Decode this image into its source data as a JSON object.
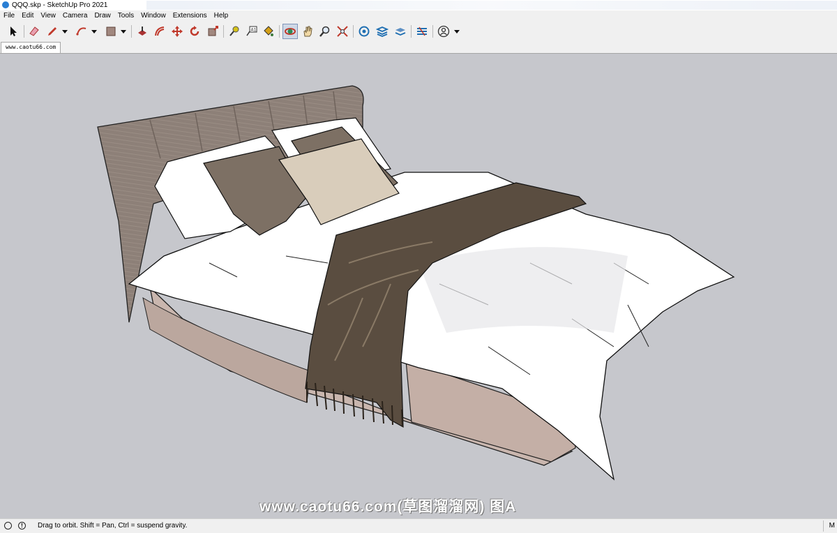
{
  "window": {
    "title": "QQQ.skp - SketchUp Pro 2021"
  },
  "menu": [
    "File",
    "Edit",
    "View",
    "Camera",
    "Draw",
    "Tools",
    "Window",
    "Extensions",
    "Help"
  ],
  "toolbar": {
    "tools": [
      {
        "name": "select-icon"
      },
      {
        "name": "eraser-icon"
      },
      {
        "name": "pencil-icon"
      },
      {
        "name": "arc-icon"
      },
      {
        "name": "rectangle-icon"
      },
      {
        "name": "push-pull-icon"
      },
      {
        "name": "offset-icon"
      },
      {
        "name": "move-icon"
      },
      {
        "name": "rotate-icon"
      },
      {
        "name": "scale-icon"
      },
      {
        "name": "tape-measure-icon"
      },
      {
        "name": "text-icon"
      },
      {
        "name": "paint-bucket-icon"
      },
      {
        "name": "orbit-icon"
      },
      {
        "name": "pan-icon"
      },
      {
        "name": "zoom-icon"
      },
      {
        "name": "zoom-extents-icon"
      },
      {
        "name": "3d-warehouse-icon"
      },
      {
        "name": "extension-warehouse-icon"
      },
      {
        "name": "layout-icon"
      },
      {
        "name": "extension-manager-icon"
      },
      {
        "name": "account-icon"
      }
    ],
    "active_tool": "orbit-icon"
  },
  "scene_tab": {
    "label": "www.caotu66.com"
  },
  "viewport": {
    "background": "#c6c7cc",
    "watermark": "www.caotu66.com(草图溜溜网) 图A"
  },
  "status": {
    "message": "Drag to orbit. Shift = Pan, Ctrl = suspend gravity.",
    "measurement_label": "M"
  },
  "colors": {
    "headboard": "#8d8078",
    "bed_base": "#c9b6ae",
    "sheet": "#ffffff",
    "throw": "#5a4d40",
    "pillow_dark": "#7d7064",
    "pillow_light": "#d9cdbb"
  }
}
